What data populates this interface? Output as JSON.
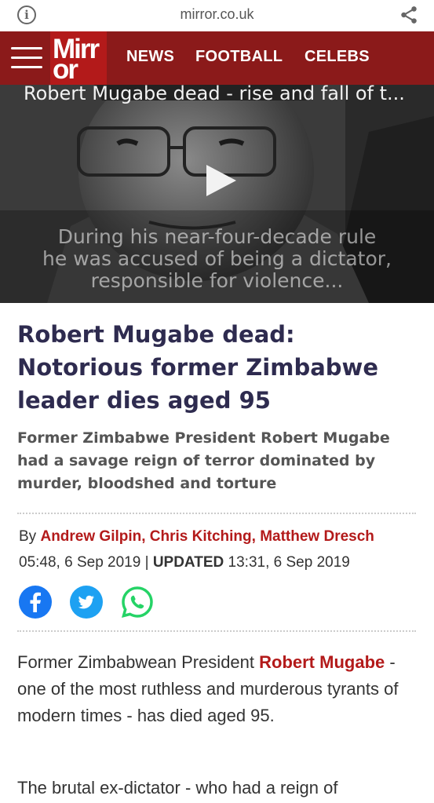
{
  "browser": {
    "url": "mirror.co.uk",
    "info_icon": "info-icon",
    "share_icon": "share-icon"
  },
  "header": {
    "logo_line1": "Mirr",
    "logo_line2": "or",
    "nav": [
      "NEWS",
      "FOOTBALL",
      "CELEBS"
    ],
    "brand_color": "#8b1a1a"
  },
  "video": {
    "title": "Robert Mugabe dead - rise and fall of t...",
    "caption_lines": [
      "During his near-four-decade rule",
      "he was accused of being a dictator,",
      "responsible for violence..."
    ]
  },
  "article": {
    "headline": "Robert Mugabe dead: Notorious former Zimbabwe leader dies aged 95",
    "standfirst": "Former Zimbabwe President Robert Mugabe had a savage reign of terror dominated by murder, bloodshed and torture",
    "byline_prefix": "By",
    "authors": "Andrew Gilpin, Chris Kitching, Matthew Dresch",
    "published": "05:48, 6 Sep 2019",
    "separator": "|",
    "updated_label": "UPDATED",
    "updated": "13:31, 6 Sep 2019",
    "para1_start": "Former Zimbabwean President ",
    "para1_link": "Robert Mugabe",
    "para1_end": " - one of the most ruthless and murderous tyrants of modern times - has died aged 95.",
    "para2": "The brutal ex-dictator - who had a reign of"
  },
  "social": {
    "facebook_color": "#1877f2",
    "twitter_color": "#1da1f2",
    "whatsapp_color": "#25d366"
  }
}
